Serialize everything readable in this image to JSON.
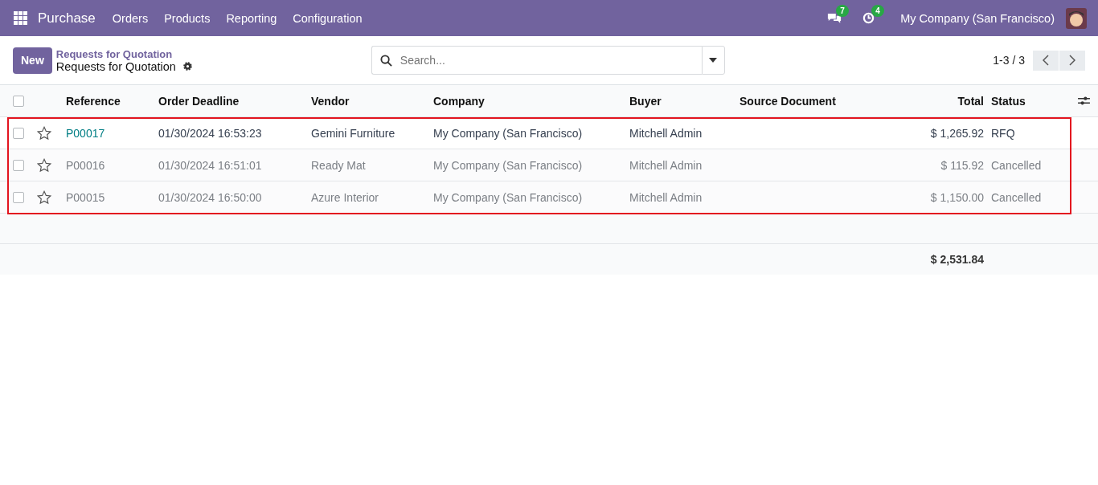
{
  "navbar": {
    "app_name": "Purchase",
    "menu": [
      "Orders",
      "Products",
      "Reporting",
      "Configuration"
    ],
    "messages_badge": "7",
    "activities_badge": "4",
    "company": "My Company (San Francisco)"
  },
  "control_panel": {
    "new_button": "New",
    "breadcrumb": "Requests for Quotation",
    "title": "Requests for Quotation",
    "search": {
      "placeholder": "Search..."
    },
    "pager": "1-3 / 3"
  },
  "table": {
    "columns": [
      "Reference",
      "Order Deadline",
      "Vendor",
      "Company",
      "Buyer",
      "Source Document",
      "Total",
      "Status"
    ],
    "select_all_checked": false,
    "rows": [
      {
        "checked": false,
        "starred": false,
        "muted": false,
        "cells": [
          "P00017",
          "01/30/2024 16:53:23",
          "Gemini Furniture",
          "My Company (San Francisco)",
          "Mitchell Admin",
          "",
          "$ 1,265.92",
          "RFQ"
        ]
      },
      {
        "checked": false,
        "starred": false,
        "muted": true,
        "cells": [
          "P00016",
          "01/30/2024 16:51:01",
          "Ready Mat",
          "My Company (San Francisco)",
          "Mitchell Admin",
          "",
          "$ 115.92",
          "Cancelled"
        ]
      },
      {
        "checked": false,
        "starred": false,
        "muted": true,
        "cells": [
          "P00015",
          "01/30/2024 16:50:00",
          "Azure Interior",
          "My Company (San Francisco)",
          "Mitchell Admin",
          "",
          "$ 1,150.00",
          "Cancelled"
        ]
      }
    ],
    "highlighted": true,
    "total": "$ 2,531.84"
  }
}
